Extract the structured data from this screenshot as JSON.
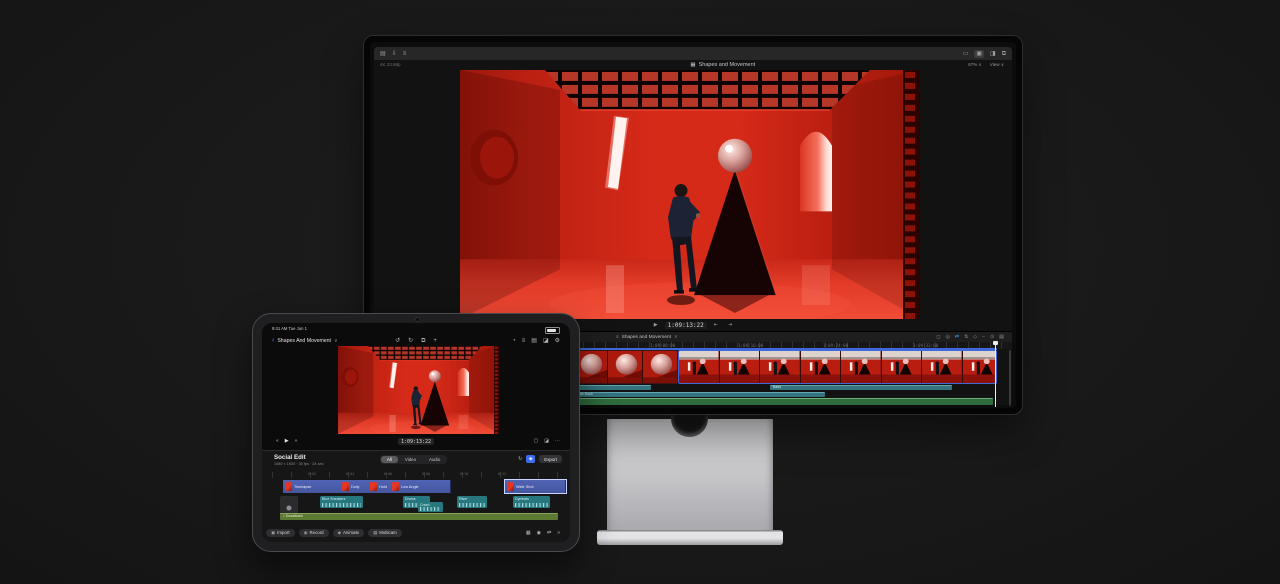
{
  "scene_description": "Red room music video: ceiling light grid, disco ball on black pyramid, dancer in dark suit",
  "colors": {
    "accent_blue": "#3f68d9",
    "timeline_teal": "#35747e",
    "timeline_green": "#2e6b3d",
    "clip_indigo": "#46579f",
    "scene_red": "#d62a19"
  },
  "mac": {
    "window": {
      "toolbar_icons_left": [
        {
          "glyph": "▤"
        },
        {
          "glyph": "⇩"
        },
        {
          "glyph": "≡"
        }
      ],
      "toolbar_icons_right": [
        {
          "glyph": "▭"
        },
        {
          "glyph": "▣"
        },
        {
          "glyph": "◨"
        },
        {
          "glyph": "⧉"
        }
      ],
      "viewer_info": "4K 23.98p",
      "project_icon_glyph": "▦",
      "project_title": "Shapes and Movement",
      "zoom_label": "67% ∨",
      "view_label": "View ∨"
    },
    "viewer": {
      "play_glyph": "▶",
      "timecode": "1:09:13:22",
      "loop_glyph": "⇤",
      "range_glyph": "⇥"
    },
    "timeline": {
      "index_glyph": "≡",
      "project_label": "Shapes and Movement",
      "caret": "∨",
      "tool_icons": [
        {
          "glyph": "◻"
        },
        {
          "glyph": "◎"
        },
        {
          "glyph": "⇄"
        },
        {
          "glyph": "⇅"
        },
        {
          "glyph": "◇"
        },
        {
          "glyph": "−"
        },
        {
          "glyph": "⊙"
        },
        {
          "glyph": "▤"
        }
      ],
      "ruler_labels": [
        "1:09:08:00",
        "1:09:16:00",
        "1:09:24:00",
        "1:09:32:00"
      ],
      "audio_row1_label": "Bass",
      "audio_row2_label": "Acoustic Rock"
    }
  },
  "ipad": {
    "status": {
      "time_text": "9:41 AM  Tue Jun 1"
    },
    "nav": {
      "back_glyph": "‹",
      "project_label": "Shapes And Movement",
      "caret": "∨",
      "center_icons": [
        {
          "glyph": "↺"
        },
        {
          "glyph": "↻"
        },
        {
          "glyph": "⧉"
        },
        {
          "glyph": "+"
        }
      ],
      "right_icons": [
        {
          "glyph": "◔"
        },
        {
          "glyph": "≡"
        },
        {
          "glyph": "▤"
        },
        {
          "glyph": "◪"
        },
        {
          "glyph": "⚙"
        }
      ]
    },
    "transport": {
      "back_glyph": "«",
      "play_glyph": "▶",
      "fwd_glyph": "»",
      "timecode": "1:09:13:22",
      "expand_glyph": "▢",
      "pip_glyph": "◪",
      "more_glyph": "⋯"
    },
    "timeline": {
      "title": "Social Edit",
      "meta": "1080 × 1920 · 30 fps · 24 sec",
      "segments": [
        "All",
        "Video",
        "Audio"
      ],
      "refresh_glyph": "↻",
      "inspector_glyph": "◈",
      "export_label": "Export",
      "ruler_labels": [
        "0:02",
        "0:04",
        "0:06",
        "0:08",
        "0:10",
        "0:12"
      ],
      "video_clips": [
        {
          "name": "Timelapse"
        },
        {
          "name": "Dolly"
        },
        {
          "name": "Hold"
        },
        {
          "name": "Low Angle"
        },
        {
          "name": "Wide Shot"
        }
      ],
      "audio_clips": [
        {
          "name": "Blue Sneakers"
        },
        {
          "name": "Drums"
        },
        {
          "name": "Riser"
        },
        {
          "name": "Cymbals"
        },
        {
          "name": "Crash"
        }
      ],
      "music_label": "♪ Soundtrack"
    },
    "dock": {
      "buttons": [
        {
          "glyph": "▣",
          "label": "Import"
        },
        {
          "glyph": "◉",
          "label": "Record"
        },
        {
          "glyph": "◆",
          "label": "Animate"
        },
        {
          "glyph": "▦",
          "label": "Multicam"
        }
      ],
      "right_icons": [
        {
          "glyph": "▦"
        },
        {
          "glyph": "◉"
        },
        {
          "glyph": "⇄"
        },
        {
          "glyph": "»"
        }
      ]
    }
  }
}
